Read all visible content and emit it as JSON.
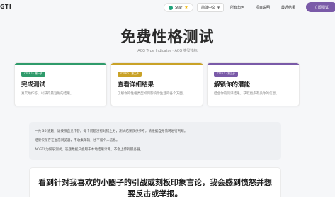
{
  "nav": {
    "brand": "GTI",
    "star_label": "Star",
    "language": "简体中文",
    "links": [
      "所有角色",
      "项目说明",
      "最近结果"
    ],
    "cta": "立即测试"
  },
  "hero": {
    "title": "免费性格测试",
    "subtitle": "ACG Type Indicator · ACG 类型指标"
  },
  "steps": [
    {
      "tag": "STEP 1 · 第一步",
      "title": "完成测试",
      "desc": "真实地作答，以获得最准确的结果。",
      "color": "#2f9b6b"
    },
    {
      "tag": "STEP 2 · 第二步",
      "title": "查看详细结果",
      "desc": "了解你的性格类型如何影响你生活的各个方面。",
      "color": "#c9a227"
    },
    {
      "tag": "STEP 3 · 第三步",
      "title": "解锁你的潜能",
      "desc": "结合你的测评结果，获取更多有关你的信息。",
      "color": "#7a5aa8"
    }
  ],
  "info": {
    "lines": [
      "一共 36 道题，请按照直觉作答。每个问题没有对错之分，测试结果仅供参考，请根据自身情况进行判断。",
      "结果仅保存在当前浏览器，不收集邮箱，也不留个人信息。",
      "ACGTI 为娱乐测试，答题数据只会用于本地结果计算，不会上传到服务器。"
    ]
  },
  "question": {
    "line1": "看到针对我喜欢的小圈子的引战或刻板印象言论，我会感到愤怒并想",
    "line2": "要反击或举报。"
  },
  "colors": {
    "accent": "#7a5aa8",
    "background": "#f6f7f9"
  }
}
